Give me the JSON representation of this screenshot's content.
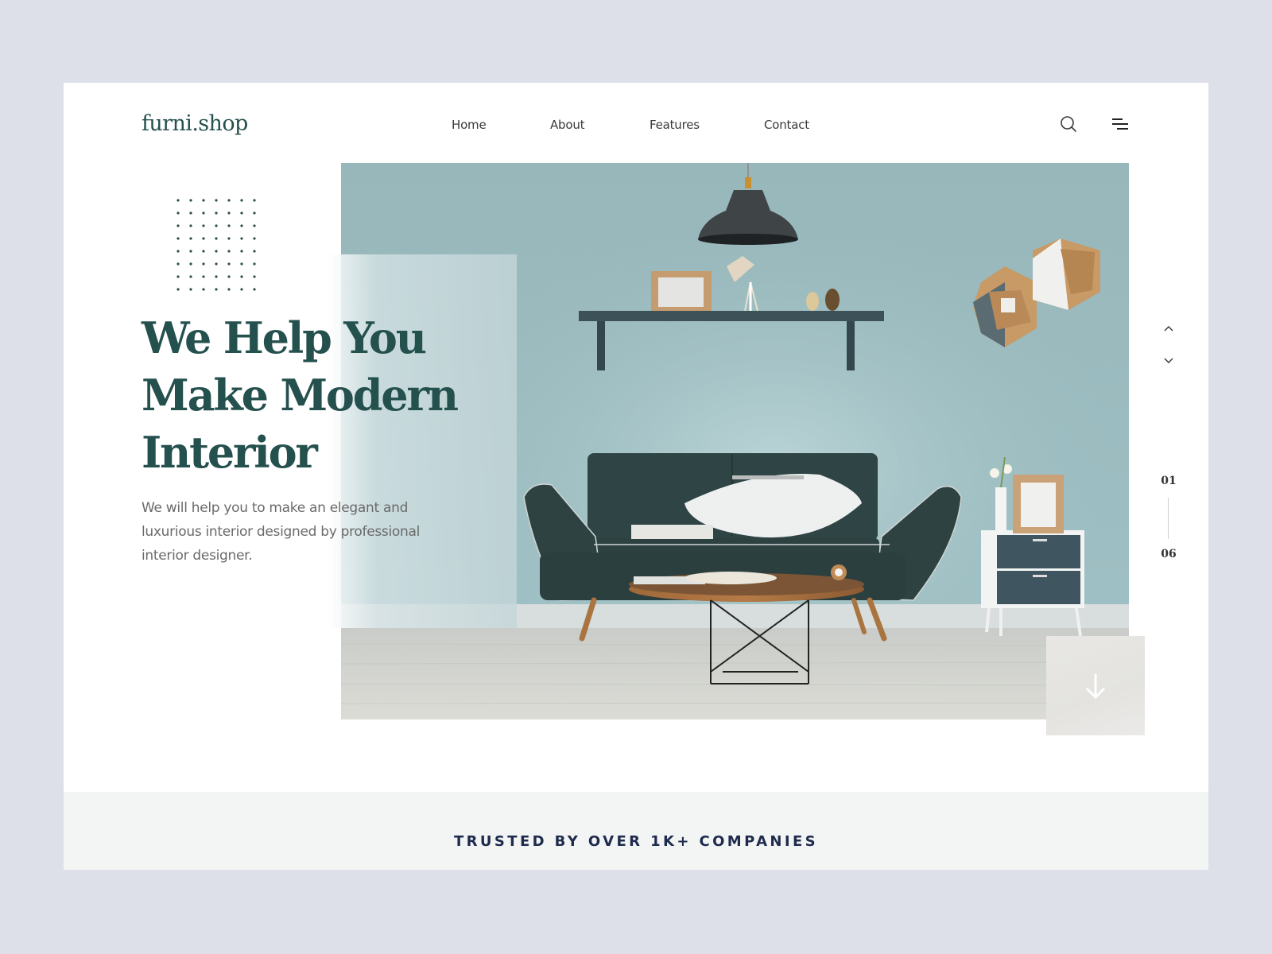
{
  "brand": {
    "logo": "furni.shop",
    "primary_color": "#24504e",
    "accent_bg": "#9cbdc1"
  },
  "nav": {
    "items": [
      {
        "label": "Home"
      },
      {
        "label": "About"
      },
      {
        "label": "Features"
      },
      {
        "label": "Contact"
      }
    ],
    "search_icon": "search-icon",
    "menu_icon": "hamburger-menu-icon"
  },
  "hero": {
    "headline_lines": [
      "We Help You",
      "Make Modern",
      "Interior"
    ],
    "description": "We will help you to make an elegant and luxurious interior designed by professional interior designer.",
    "image_description": "Living room with dark green sofa, white pillow, round wooden coffee table, pendant lamp, wall shelf with frame and lamp, hexagon wall shelves, and a small drawer cabinet with flowers and frame on a light teal wall"
  },
  "slider": {
    "current": "01",
    "total": "06",
    "up_icon": "chevron-up-icon",
    "down_icon": "chevron-down-icon"
  },
  "scroll_button": {
    "icon": "arrow-down-icon"
  },
  "trusted": {
    "text": "TRUSTED BY OVER 1K+ COMPANIES"
  }
}
